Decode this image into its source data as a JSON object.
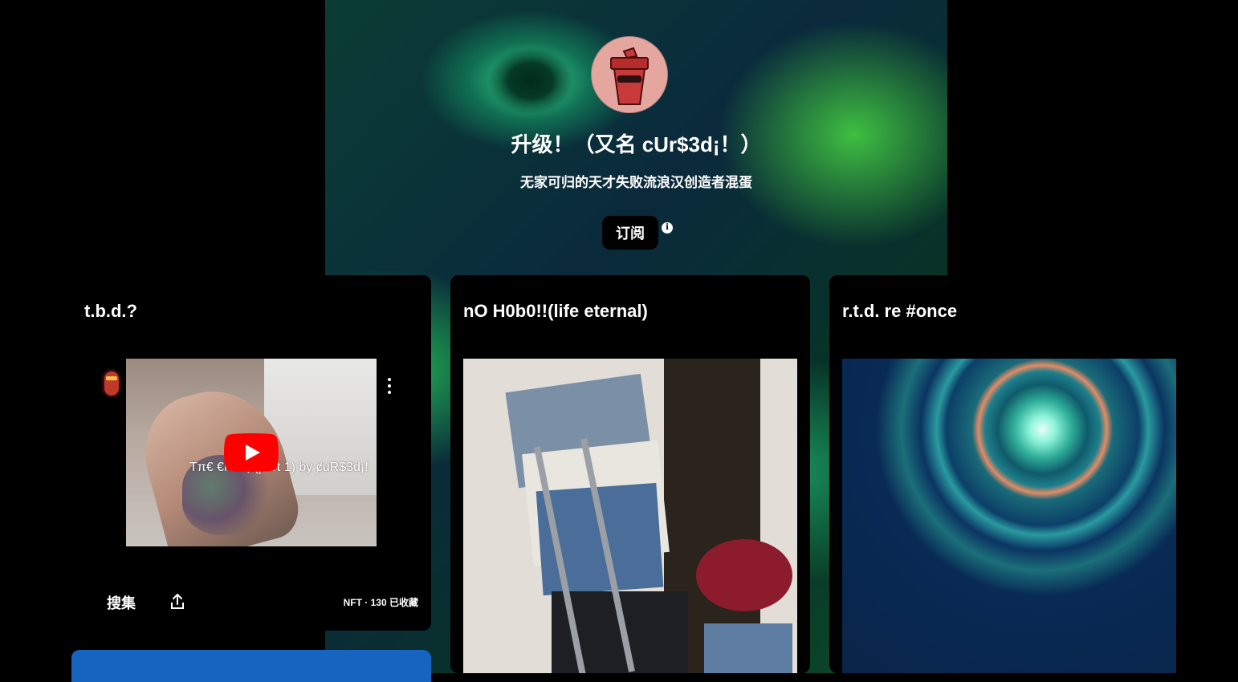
{
  "profile": {
    "title": "升级！（又名 cUr$3d¡！）",
    "subtitle": "无家可归的天才失败流浪汉创造者混蛋",
    "subscribe_label": "订阅",
    "info_icon": "i"
  },
  "cards": [
    {
      "title": "t.b.d.?",
      "video_title": "Tπ€ €ND!¡ (part 1) by ȼuR$3d¡!",
      "collect_label": "搜集",
      "meta": "NFT · 130 已收藏"
    },
    {
      "title": "nO H0b0!!(life eternal)"
    },
    {
      "title": "r.t.d. re #once"
    }
  ],
  "colors": {
    "background": "#000000",
    "youtube_red": "#ff0000",
    "bottom_bar": "#1565c0"
  }
}
